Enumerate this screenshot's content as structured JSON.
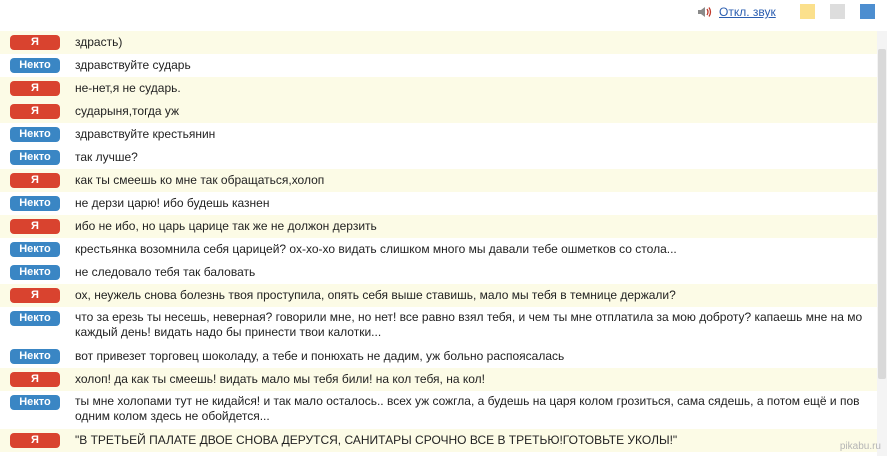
{
  "toolbar": {
    "sound_label": "Откл. звук",
    "sound_icon": "speaker-icon",
    "themes": [
      "#fbe08c",
      "#dddddd",
      "#4d8ed0"
    ]
  },
  "labels": {
    "me": "Я",
    "other": "Некто"
  },
  "messages": [
    {
      "who": "me",
      "text": "здрасть)"
    },
    {
      "who": "other",
      "text": "здравствуйте сударь"
    },
    {
      "who": "me",
      "text": "не-нет,я не сударь."
    },
    {
      "who": "me",
      "text": "сударыня,тогда уж"
    },
    {
      "who": "other",
      "text": "здравствуйте крестьянин"
    },
    {
      "who": "other",
      "text": "так лучше?"
    },
    {
      "who": "me",
      "text": "как ты смеешь ко мне так обращаться,холоп"
    },
    {
      "who": "other",
      "text": "не дерзи царю! ибо будешь казнен"
    },
    {
      "who": "me",
      "text": "ибо не ибо, но царь царице так же не должон дерзить"
    },
    {
      "who": "other",
      "text": "крестьянка возомнила себя царицей? ох-хо-хо видать слишком много мы давали тебе ошметков со стола..."
    },
    {
      "who": "other",
      "text": "не следовало тебя так баловать"
    },
    {
      "who": "me",
      "text": "ох, неужель снова болезнь твоя проступила, опять себя выше ставишь, мало мы тебя в темнице держали?"
    },
    {
      "who": "other",
      "text": "что за ерезь ты несешь, неверная? говорили мне, но нет! все равно взял тебя, и чем ты мне отплатила за мою доброту? капаешь мне на мо\nкаждый день! видать надо бы принести твои калотки..."
    },
    {
      "who": "other",
      "text": "вот привезет торговец шоколаду, а тебе и понюхать не дадим, уж больно распоясалась"
    },
    {
      "who": "me",
      "text": "холоп! да как ты смеешь! видать мало мы тебя били! на кол тебя, на кол!"
    },
    {
      "who": "other",
      "text": "ты мне холопами тут не кидайся! и так мало осталось.. всех уж сожгла, а будешь на царя колом грозиться, сама сядешь, а потом ещё и пов\nодним колом здесь не обойдется..."
    },
    {
      "who": "me",
      "text": "\"В ТРЕТЬЕЙ ПАЛАТЕ ДВОЕ СНОВА ДЕРУТСЯ, САНИТАРЫ СРОЧНО ВСЕ В ТРЕТЬЮ!ГОТОВЬТЕ УКОЛЫ!\""
    }
  ],
  "watermark": "pikabu.ru"
}
